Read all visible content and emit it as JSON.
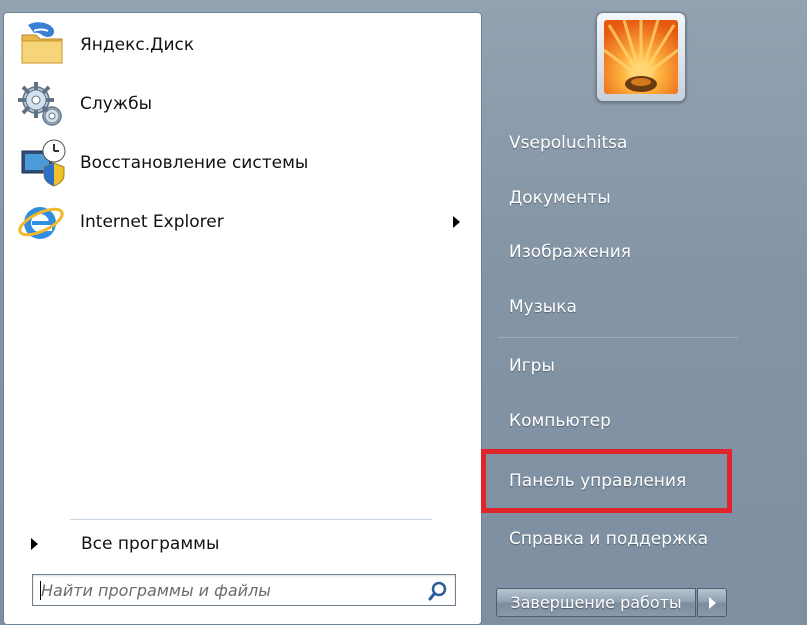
{
  "programs": [
    {
      "label": "Яндекс.Диск",
      "icon": "yandex-disk-folder-icon"
    },
    {
      "label": "Службы",
      "icon": "services-gears-icon"
    },
    {
      "label": "Восстановление системы",
      "icon": "system-restore-icon"
    },
    {
      "label": "Internet Explorer",
      "icon": "internet-explorer-icon",
      "has_submenu": true
    }
  ],
  "all_programs": {
    "label": "Все программы"
  },
  "search": {
    "placeholder": "Найти программы и файлы",
    "icon": "search-icon"
  },
  "user": {
    "avatar": "flower-avatar"
  },
  "right_menu": [
    {
      "label": "Vsepoluchitsa"
    },
    {
      "label": "Документы"
    },
    {
      "label": "Изображения"
    },
    {
      "label": "Музыка"
    },
    {
      "label": "Игры"
    },
    {
      "label": "Компьютер"
    },
    {
      "label": "Панель управления",
      "highlighted": true
    },
    {
      "label": "Справка и поддержка"
    }
  ],
  "shutdown": {
    "label": "Завершение работы"
  },
  "colors": {
    "highlight": "#e0242b",
    "panel_bg": "#8394a5"
  }
}
